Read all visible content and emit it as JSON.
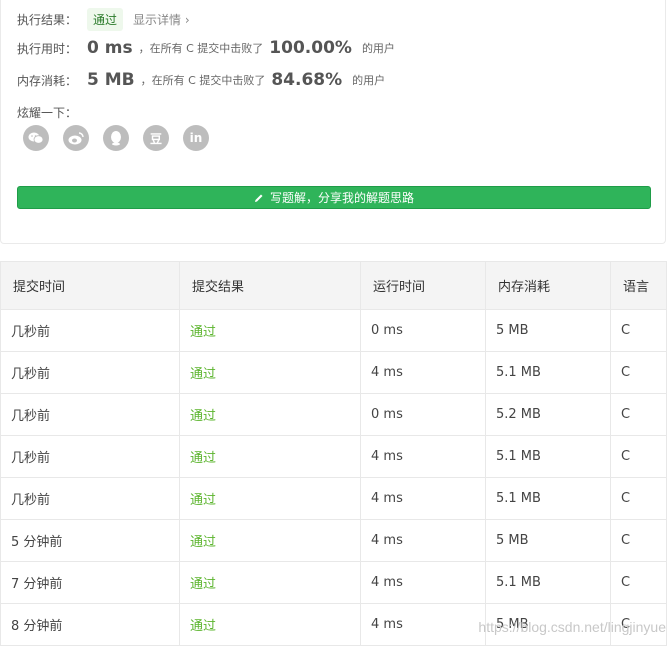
{
  "result": {
    "label": "执行结果：",
    "status": "通过",
    "details_link": "显示详情 ›"
  },
  "runtime": {
    "label": "执行用时：",
    "value": "0 ms",
    "prefix": "，在所有 C 提交中击败了",
    "percent": "100.00%",
    "suffix": "的用户"
  },
  "memory": {
    "label": "内存消耗：",
    "value": "5 MB",
    "prefix": "，在所有 C 提交中击败了",
    "percent": "84.68%",
    "suffix": "的用户"
  },
  "share": {
    "label": "炫耀一下：",
    "icons": [
      "wechat-icon",
      "weibo-icon",
      "qq-icon",
      "douban-icon",
      "linkedin-icon"
    ],
    "douban_glyph": "豆",
    "linkedin_glyph": "in"
  },
  "write_button": "写题解，分享我的解题思路",
  "table": {
    "headers": [
      "提交时间",
      "提交结果",
      "运行时间",
      "内存消耗",
      "语言"
    ],
    "rows": [
      [
        "几秒前",
        "通过",
        "0 ms",
        "5 MB",
        "C"
      ],
      [
        "几秒前",
        "通过",
        "4 ms",
        "5.1 MB",
        "C"
      ],
      [
        "几秒前",
        "通过",
        "0 ms",
        "5.2 MB",
        "C"
      ],
      [
        "几秒前",
        "通过",
        "4 ms",
        "5.1 MB",
        "C"
      ],
      [
        "几秒前",
        "通过",
        "4 ms",
        "5.1 MB",
        "C"
      ],
      [
        "5 分钟前",
        "通过",
        "4 ms",
        "5 MB",
        "C"
      ],
      [
        "7 分钟前",
        "通过",
        "4 ms",
        "5.1 MB",
        "C"
      ],
      [
        "8 分钟前",
        "通过",
        "4 ms",
        "5 MB",
        "C"
      ]
    ]
  },
  "watermark": "https://blog.csdn.net/lingjinyue",
  "colors": {
    "accent_green": "#2fb45a",
    "pass_text": "#5bb42d",
    "icon_grey": "#bdbdbd"
  }
}
